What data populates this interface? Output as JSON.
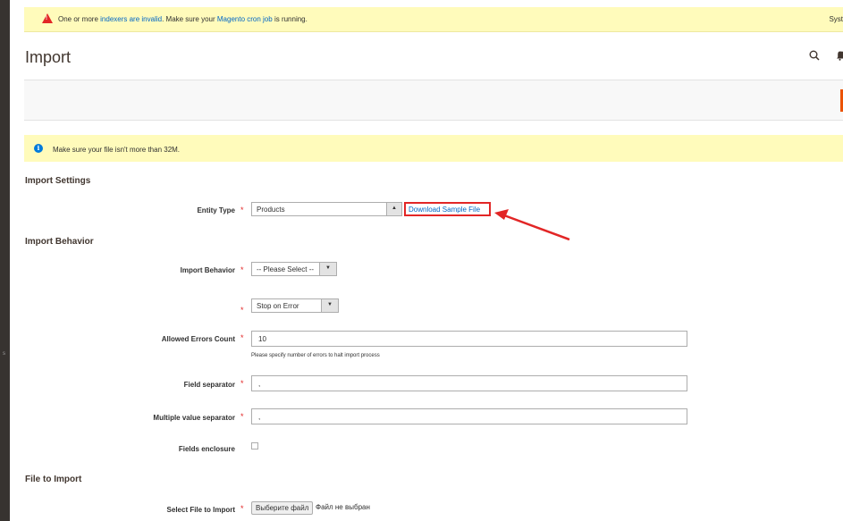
{
  "system_message": {
    "part1": "One or more ",
    "link_indexers": "indexers are invalid",
    "part2": ". Make sure your ",
    "link_cron": "Magento cron job",
    "part3": " is running.",
    "right_text": "Syst"
  },
  "header": {
    "title": "Import"
  },
  "icons": {
    "search": "search-icon",
    "bell": "bell-icon",
    "warning": "warning-icon",
    "info": "info-icon"
  },
  "notice": {
    "text": "Make sure your file isn't more than 32M."
  },
  "import_settings": {
    "title": "Import Settings",
    "entity_type_label": "Entity Type",
    "entity_type_value": "Products",
    "download_link": "Download Sample File"
  },
  "import_behavior": {
    "title": "Import Behavior",
    "behavior_label": "Import Behavior",
    "behavior_value": "-- Please Select --",
    "validation_value": "Stop on Error",
    "allowed_errors_label": "Allowed Errors Count",
    "allowed_errors_value": "10",
    "allowed_errors_note": "Please specify number of errors to halt import process",
    "field_separator_label": "Field separator",
    "field_separator_value": ",",
    "multi_separator_label": "Multiple value separator",
    "multi_separator_value": ",",
    "fields_enclosure_label": "Fields enclosure"
  },
  "file_to_import": {
    "title": "File to Import",
    "select_label": "Select File to Import",
    "button_label": "Выберите файл",
    "status": "Файл не выбран"
  },
  "required_marker": "*",
  "colors": {
    "required": "#e22626",
    "link": "#0066c5",
    "accent": "#eb5202",
    "message_bg": "#fffbbb"
  }
}
